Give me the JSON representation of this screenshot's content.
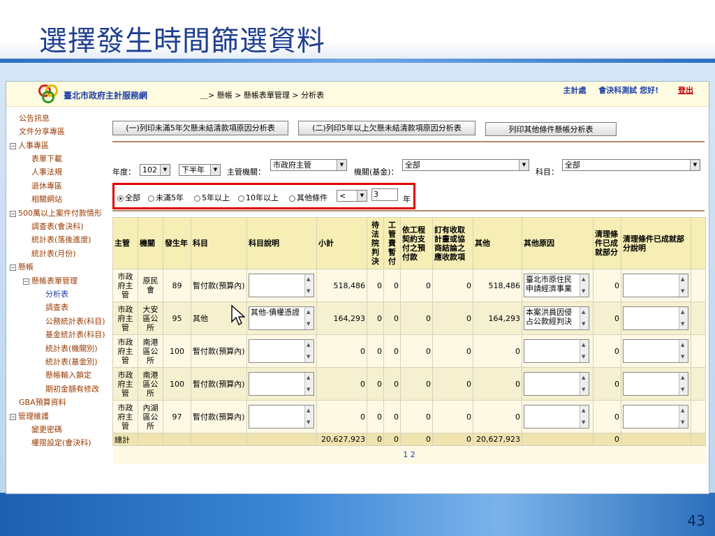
{
  "slide": {
    "title": "選擇發生時間篩選資料",
    "number": "43"
  },
  "header": {
    "site_name": "臺北市政府主計服務網",
    "breadcrumb": "＿> 懸帳 > 懸帳表單管理 > 分析表",
    "org": "主計處",
    "greeting": "會決科測試 您好!",
    "logout": "登出"
  },
  "sidebar": {
    "items": [
      {
        "label": "公告訊息"
      },
      {
        "label": "文件分享專區"
      },
      {
        "label": "人事專區"
      },
      {
        "label": "表單下載"
      },
      {
        "label": "人事法規"
      },
      {
        "label": "退休專區"
      },
      {
        "label": "相關網站"
      },
      {
        "label": "500萬以上案件付款情形"
      },
      {
        "label": "調查表(會決科)"
      },
      {
        "label": "統計表(落後進度)"
      },
      {
        "label": "統計表(月份)"
      },
      {
        "label": "懸帳"
      },
      {
        "label": "懸帳表單管理"
      },
      {
        "label": "分析表"
      },
      {
        "label": "調查表"
      },
      {
        "label": "公務統計表(科目)"
      },
      {
        "label": "基金統計表(科目)"
      },
      {
        "label": "統計表(機關別)"
      },
      {
        "label": "統計表(基金別)"
      },
      {
        "label": "懸帳輸入鎖定"
      },
      {
        "label": "期初金額有修改"
      },
      {
        "label": "GBA預算資料"
      },
      {
        "label": "管理維護"
      },
      {
        "label": "變更密碼"
      },
      {
        "label": "權限設定(會決科)"
      }
    ]
  },
  "toolbar": {
    "btn1": "(一)列印未滿5年欠懸未結清款項原因分析表",
    "btn2": "(二)列印5年以上欠懸未結清款項原因分析表",
    "btn3": "列印其他條件懸帳分析表"
  },
  "filters": {
    "year_label": "年度：",
    "year_value": "102",
    "half_value": "下半年",
    "agency_label": "主管機關：",
    "agency_value": "市政府主管",
    "org_label": "機關(基金)：",
    "org_value": "全部",
    "subject_label": "科目：",
    "subject_value": "全部"
  },
  "period_filter": {
    "opt_all": "全部",
    "opt_lt5": "未滿5年",
    "opt_ge5": "5年以上",
    "opt_ge10": "10年以上",
    "opt_other": "其他條件",
    "operator": "<",
    "years_value": "3",
    "unit": "年"
  },
  "table": {
    "headers": {
      "agency": "主管",
      "org": "機關",
      "year": "發生年",
      "subject": "科目",
      "subject_desc": "科目說明",
      "subtotal": "小計",
      "pending_court": "待法院判決",
      "eng_fee": "工管費暫付",
      "eng_contract": "依工程契約支付之預付款",
      "receivable": "訂有收取計畫或協商結論之應收款項",
      "other": "其他",
      "other_reason": "其他原因",
      "cleared": "清理條件已成就部分",
      "cleared_desc": "清理條件已成就部分說明"
    },
    "rows": [
      {
        "agency": "市政府主管",
        "org": "原民會",
        "year": "89",
        "subject": "暫付款(預算內)",
        "subject_desc": "",
        "subtotal": "518,486",
        "c1": "0",
        "c2": "0",
        "c3": "0",
        "c4": "0",
        "other": "518,486",
        "other_reason": "臺北市原住民申請經濟事業",
        "cleared": "0",
        "cleared_desc": ""
      },
      {
        "agency": "市政府主管",
        "org": "大安區公所",
        "year": "95",
        "subject": "其他",
        "subject_desc": "其他-債權憑證",
        "subtotal": "164,293",
        "c1": "0",
        "c2": "0",
        "c3": "0",
        "c4": "0",
        "other": "164,293",
        "other_reason": "本案洪員因侵占公款經判決",
        "cleared": "0",
        "cleared_desc": ""
      },
      {
        "agency": "市政府主管",
        "org": "南港區公所",
        "year": "100",
        "subject": "暫付款(預算內)",
        "subject_desc": "",
        "subtotal": "0",
        "c1": "0",
        "c2": "0",
        "c3": "0",
        "c4": "0",
        "other": "0",
        "other_reason": "",
        "cleared": "0",
        "cleared_desc": ""
      },
      {
        "agency": "市政府主管",
        "org": "南港區公所",
        "year": "100",
        "subject": "暫付款(預算內)",
        "subject_desc": "",
        "subtotal": "0",
        "c1": "0",
        "c2": "0",
        "c3": "0",
        "c4": "0",
        "other": "0",
        "other_reason": "",
        "cleared": "0",
        "cleared_desc": ""
      },
      {
        "agency": "市政府主管",
        "org": "內湖區公所",
        "year": "97",
        "subject": "暫付款(預算內)",
        "subject_desc": "",
        "subtotal": "0",
        "c1": "0",
        "c2": "0",
        "c3": "0",
        "c4": "0",
        "other": "0",
        "other_reason": "",
        "cleared": "0",
        "cleared_desc": ""
      }
    ],
    "total": {
      "label": "總計",
      "subtotal": "20,627,923",
      "c1": "0",
      "c2": "0",
      "c3": "0",
      "c4": "0",
      "other": "20,627,923",
      "cleared": "0"
    },
    "pager": {
      "p1": "1",
      "p2": "2"
    }
  }
}
